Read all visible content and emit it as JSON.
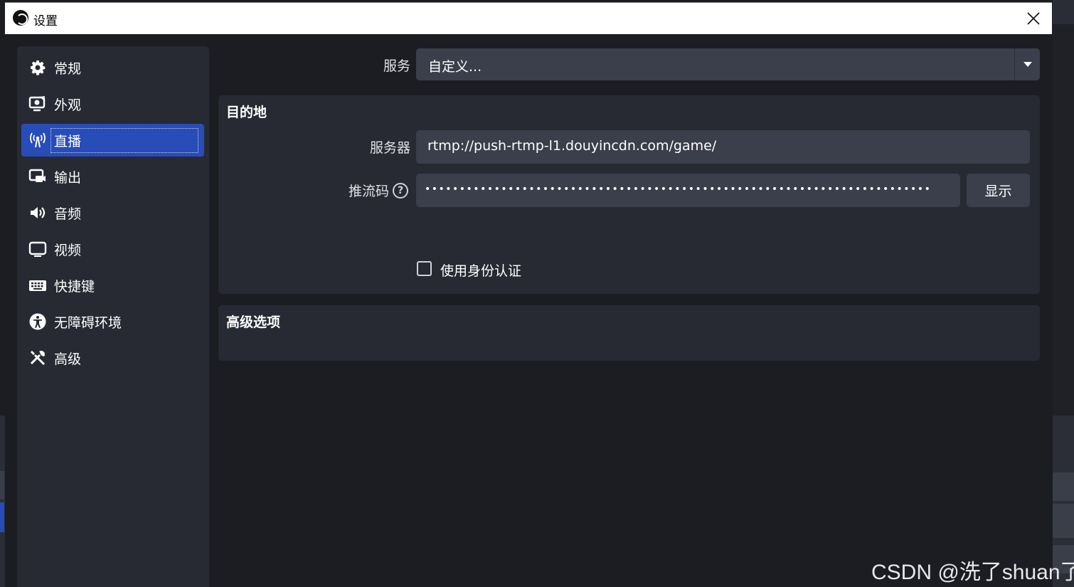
{
  "window": {
    "title": "设置",
    "close_icon": "close-icon"
  },
  "sidebar": {
    "items": [
      {
        "label": "常规",
        "icon": "gear-icon"
      },
      {
        "label": "外观",
        "icon": "appearance-icon"
      },
      {
        "label": "直播",
        "icon": "broadcast-antenna-icon",
        "active": true
      },
      {
        "label": "输出",
        "icon": "output-icon"
      },
      {
        "label": "音频",
        "icon": "speaker-icon"
      },
      {
        "label": "视频",
        "icon": "monitor-icon"
      },
      {
        "label": "快捷键",
        "icon": "keyboard-icon"
      },
      {
        "label": "无障碍环境",
        "icon": "accessibility-icon"
      },
      {
        "label": "高级",
        "icon": "tools-icon"
      }
    ]
  },
  "service": {
    "label": "服务",
    "value": "自定义..."
  },
  "destination": {
    "title": "目的地",
    "server_label": "服务器",
    "server_value": "rtmp://push-rtmp-l1.douyincdn.com/game/",
    "stream_key_label": "推流码",
    "stream_key_masked": "•••••••••••••••••••••••••••••••••••••••••••••••••••••••••••••••••••••••••",
    "show_button": "显示",
    "auth_checkbox_label": "使用身份认证",
    "auth_checked": false
  },
  "advanced": {
    "title": "高级选项"
  },
  "watermark": "CSDN @洗了shuan了",
  "colors": {
    "accent": "#284cb8",
    "panel": "#272a33",
    "field": "#3b3f4b",
    "background": "#1b1d23"
  }
}
